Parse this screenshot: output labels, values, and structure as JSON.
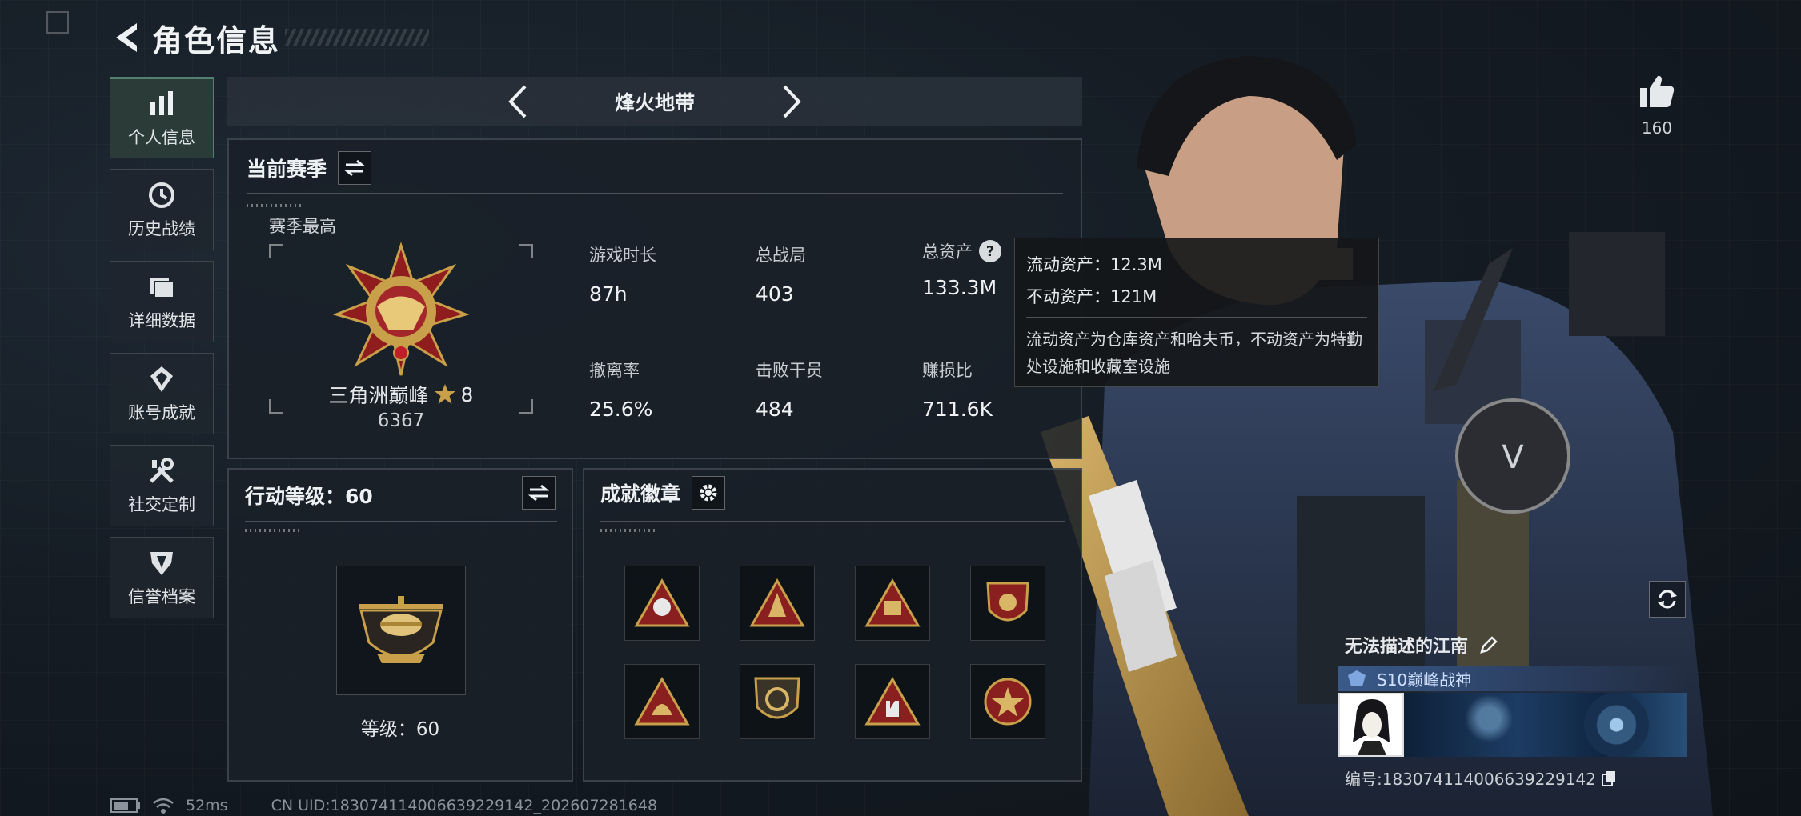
{
  "header": {
    "title": "角色信息"
  },
  "nav": {
    "items": [
      {
        "label": "个人信息",
        "icon": "bar-chart-icon",
        "active": true
      },
      {
        "label": "历史战绩",
        "icon": "history-icon"
      },
      {
        "label": "详细数据",
        "icon": "folder-icon"
      },
      {
        "label": "账号成就",
        "icon": "achievement-icon"
      },
      {
        "label": "社交定制",
        "icon": "tools-icon"
      },
      {
        "label": "信誉档案",
        "icon": "shield-icon"
      }
    ]
  },
  "map": {
    "name": "烽火地带"
  },
  "season": {
    "title": "当前赛季",
    "best_label": "赛季最高",
    "rank_name": "三角洲巅峰",
    "rank_stars": "8",
    "rank_score": "6367",
    "stats": {
      "playtime": {
        "label": "游戏时长",
        "value": "87h"
      },
      "matches": {
        "label": "总战局",
        "value": "403"
      },
      "assets": {
        "label": "总资产",
        "value": "133.3M"
      },
      "extract_rate": {
        "label": "撤离率",
        "value": "25.6%"
      },
      "kills": {
        "label": "击败干员",
        "value": "484"
      },
      "profit_ratio": {
        "label": "赚损比",
        "value": "711.6K"
      }
    }
  },
  "tooltip": {
    "liquid": "流动资产：12.3M",
    "fixed": "不动资产：121M",
    "description": "流动资产为仓库资产和哈夫币，不动资产为特勤处设施和收藏室设施"
  },
  "level": {
    "title": "行动等级：60",
    "level_text": "等级：60"
  },
  "badges": {
    "title": "成就徽章"
  },
  "profile": {
    "likes": "160",
    "name": "无法描述的江南",
    "title": "S10巅峰战神",
    "uid": "编号:18307411400663922914​2"
  },
  "status": {
    "ping": "52ms",
    "cn_uid": "CN UID:18307411400663922914​2_202607281648"
  },
  "colors": {
    "accent_green": "#37d59a",
    "gold": "#c9a04a",
    "title_blue": "#3a5a8a"
  }
}
